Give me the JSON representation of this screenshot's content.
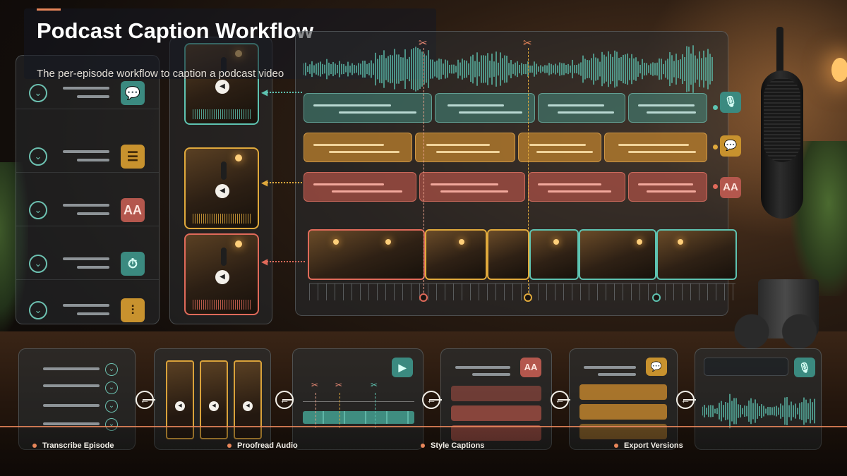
{
  "header": {
    "title": "Podcast Caption Workflow",
    "subtitle": "The per-episode workflow to caption a podcast video"
  },
  "colors": {
    "accent": "#e8865a",
    "teal": "#3b8a80",
    "gold": "#c8922e",
    "red": "#b4574d"
  },
  "step_list": {
    "rows": [
      {
        "icon": "speech-bubble-icon",
        "glyph": "💬",
        "color": "teal"
      },
      {
        "icon": "list-icon",
        "glyph": "☰",
        "color": "gold"
      },
      {
        "icon": "font-size-icon",
        "glyph": "AA",
        "color": "red"
      },
      {
        "icon": "timer-icon",
        "glyph": "⏱",
        "color": "teal"
      },
      {
        "icon": "audio-wave-icon",
        "glyph": "⫶",
        "color": "gold"
      }
    ]
  },
  "timeline": {
    "tracks": [
      {
        "name": "transcript",
        "color": "teal",
        "icon": "microphone-icon",
        "glyph": "🎙"
      },
      {
        "name": "captions",
        "color": "gold",
        "icon": "speech-bubble-icon",
        "glyph": "💬"
      },
      {
        "name": "styles",
        "color": "red",
        "icon": "font-size-icon",
        "glyph": "AA"
      }
    ]
  },
  "workflow": {
    "steps": [
      {
        "label": "Transcribe Episode"
      },
      {
        "label": "Proofread Audio"
      },
      {
        "label": "Style Captions"
      },
      {
        "label": "Export Versions"
      }
    ],
    "card_icons": {
      "timeline_card": "video-clip-icon",
      "style_card": "font-size-icon",
      "style_glyph": "AA",
      "caption_card": "speech-bubble-icon",
      "caption_glyph": "💬",
      "audio_card": "microphone-icon",
      "audio_glyph": "🎙"
    }
  },
  "glyphs": {
    "chevron": "⌄",
    "play": "◀",
    "scissors": "✂",
    "arrow_left": "←"
  }
}
